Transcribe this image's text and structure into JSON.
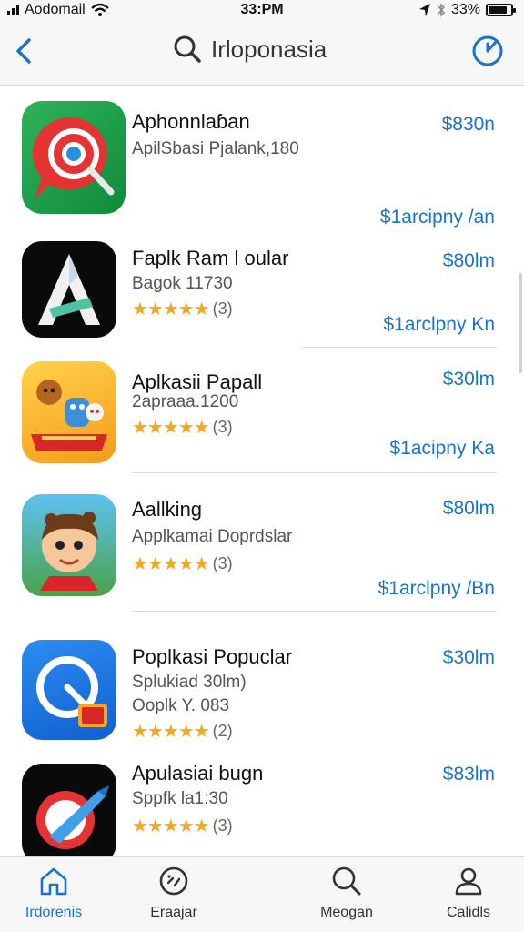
{
  "status_bar": {
    "carrier": "Aodomail",
    "time": "33:PM",
    "battery": "33%"
  },
  "nav": {
    "title": "Irloponasia",
    "icons": {
      "back": "chevron-left-icon",
      "search": "search-icon",
      "action": "compass-icon"
    }
  },
  "apps": [
    {
      "name": "Aphonnlaɓan",
      "subtitle": "ApilSbasi Pjalank,180",
      "subtitle2": "",
      "rating": "",
      "price": "$830n",
      "buy_label": "$1arcipny /an"
    },
    {
      "name": "Faplk Ram l oular",
      "subtitle": "Bagok 11730",
      "subtitle2": "",
      "rating": "(3)",
      "price": "$80lm",
      "buy_label": "$1arclpny Kn"
    },
    {
      "name": "Aplkasii Papall",
      "subtitle": "2apraaa.1200",
      "subtitle2": "",
      "rating": "(3)",
      "price": "$30lm",
      "buy_label": "$1acipny Ka"
    },
    {
      "name": "Aallking",
      "subtitle": "Applkamai Doprdslar",
      "subtitle2": "",
      "rating": "(3)",
      "price": "$80lm",
      "buy_label": "$1arclpny /Bn"
    },
    {
      "name": "Poplkasi Popuclar",
      "subtitle": "Splukiad 30lm)",
      "subtitle2": "Ooplk Y. 083",
      "rating": "(2)",
      "price": "$30lm",
      "buy_label": ""
    },
    {
      "name": "Apulasiai bugn",
      "subtitle": "Sppfk la1:30",
      "subtitle2": "",
      "rating": "(3)",
      "price": "$83lm",
      "buy_label": ""
    }
  ],
  "tabs": [
    {
      "label": "Irdorenis",
      "icon": "home-icon"
    },
    {
      "label": "Eraajar",
      "icon": "compass-icon"
    },
    {
      "label": "Meogan",
      "icon": "search-icon"
    },
    {
      "label": "Calidls",
      "icon": "person-icon"
    }
  ],
  "colors": {
    "accent": "#1a73c9",
    "star": "#f5a623",
    "background": "#ffffff",
    "bars": "#f7f7f8"
  }
}
